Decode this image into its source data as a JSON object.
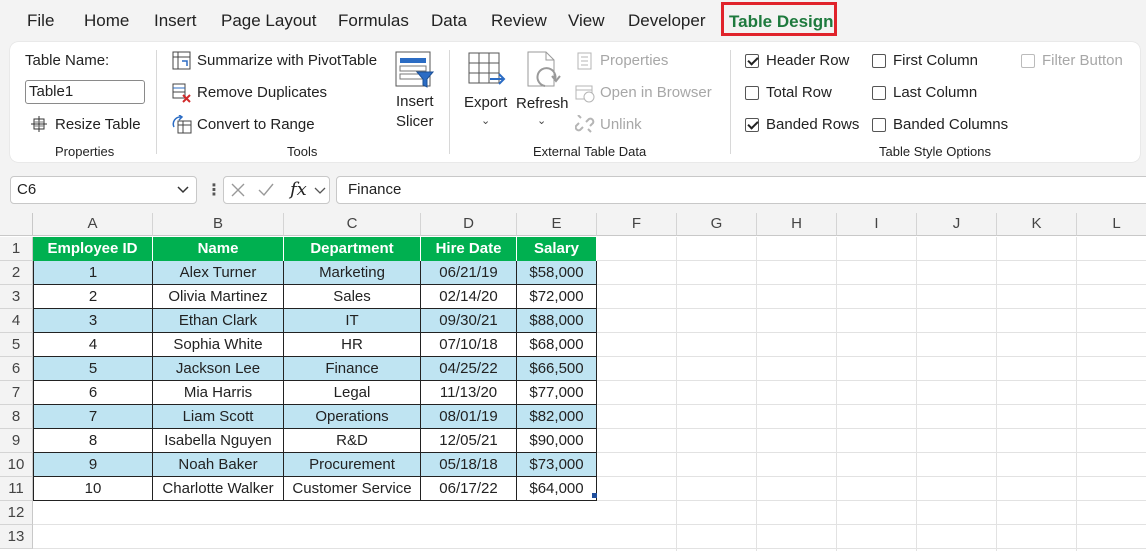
{
  "menu": {
    "tabs": [
      "File",
      "Home",
      "Insert",
      "Page Layout",
      "Formulas",
      "Data",
      "Review",
      "View",
      "Developer",
      "Table Design"
    ],
    "active": "Table Design"
  },
  "ribbon": {
    "properties": {
      "table_name_label": "Table Name:",
      "table_name_value": "Table1",
      "resize_label": "Resize Table",
      "group_label": "Properties"
    },
    "tools": {
      "summarize_label": "Summarize with PivotTable",
      "remove_duplicates_label": "Remove Duplicates",
      "convert_label": "Convert to Range",
      "insert_slicer_line1": "Insert",
      "insert_slicer_line2": "Slicer",
      "group_label": "Tools"
    },
    "external": {
      "export_label": "Export",
      "refresh_label": "Refresh",
      "properties_label": "Properties",
      "open_browser_label": "Open in Browser",
      "unlink_label": "Unlink",
      "group_label": "External Table Data"
    },
    "style_options": {
      "header_row": {
        "label": "Header Row",
        "checked": true
      },
      "total_row": {
        "label": "Total Row",
        "checked": false
      },
      "banded_rows": {
        "label": "Banded Rows",
        "checked": true
      },
      "first_column": {
        "label": "First Column",
        "checked": false
      },
      "last_column": {
        "label": "Last Column",
        "checked": false
      },
      "banded_columns": {
        "label": "Banded Columns",
        "checked": false
      },
      "filter_button": {
        "label": "Filter Button",
        "checked": false,
        "disabled": true
      },
      "group_label": "Table Style Options"
    }
  },
  "formula_bar": {
    "name_box": "C6",
    "fx": "fx",
    "formula": "Finance"
  },
  "sheet": {
    "columns": [
      "A",
      "B",
      "C",
      "D",
      "E",
      "F",
      "G",
      "H",
      "I",
      "J",
      "K",
      "L"
    ],
    "rows": [
      "1",
      "2",
      "3",
      "4",
      "5",
      "6",
      "7",
      "8",
      "9",
      "10",
      "11",
      "12",
      "13"
    ],
    "table": {
      "headers": [
        "Employee ID",
        "Name",
        "Department",
        "Hire Date",
        "Salary"
      ],
      "rows": [
        [
          "1",
          "Alex Turner",
          "Marketing",
          "06/21/19",
          "$58,000"
        ],
        [
          "2",
          "Olivia Martinez",
          "Sales",
          "02/14/20",
          "$72,000"
        ],
        [
          "3",
          "Ethan Clark",
          "IT",
          "09/30/21",
          "$88,000"
        ],
        [
          "4",
          "Sophia White",
          "HR",
          "07/10/18",
          "$68,000"
        ],
        [
          "5",
          "Jackson Lee",
          "Finance",
          "04/25/22",
          "$66,500"
        ],
        [
          "6",
          "Mia Harris",
          "Legal",
          "11/13/20",
          "$77,000"
        ],
        [
          "7",
          "Liam Scott",
          "Operations",
          "08/01/19",
          "$82,000"
        ],
        [
          "8",
          "Isabella Nguyen",
          "R&D",
          "12/05/21",
          "$90,000"
        ],
        [
          "9",
          "Noah Baker",
          "Procurement",
          "05/18/18",
          "$73,000"
        ],
        [
          "10",
          "Charlotte Walker",
          "Customer Service",
          "06/17/22",
          "$64,000"
        ]
      ]
    }
  },
  "colors": {
    "header_fill": "#00b050",
    "band_fill": "#bfe4f2",
    "active_tab_text": "#1e7a3e",
    "highlight_outline": "#e0232b"
  }
}
